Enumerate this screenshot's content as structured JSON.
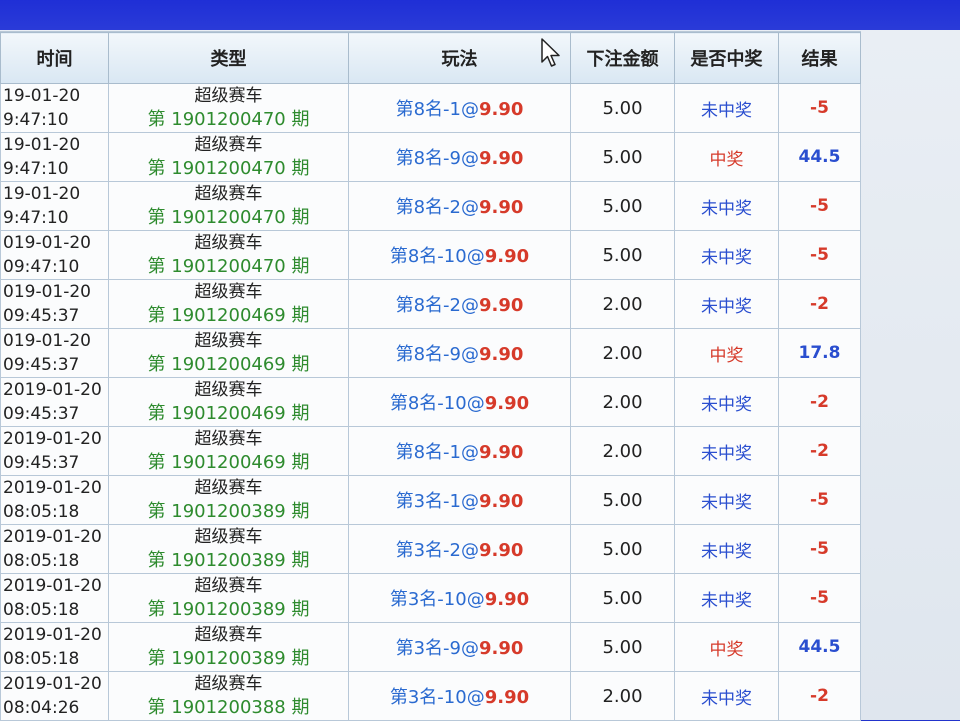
{
  "table": {
    "headers": [
      "时间",
      "类型",
      "玩法",
      "下注金额",
      "是否中奖",
      "结果"
    ],
    "rows": [
      {
        "date": "19-01-20",
        "time": "9:47:10",
        "type": "超级赛车",
        "period": "第 1901200470 期",
        "play": "第8名-1@",
        "odds": "9.90",
        "amount": "5.00",
        "status": "未中奖",
        "result": "-5",
        "win": false
      },
      {
        "date": "19-01-20",
        "time": "9:47:10",
        "type": "超级赛车",
        "period": "第 1901200470 期",
        "play": "第8名-9@",
        "odds": "9.90",
        "amount": "5.00",
        "status": "中奖",
        "result": "44.5",
        "win": true
      },
      {
        "date": "19-01-20",
        "time": "9:47:10",
        "type": "超级赛车",
        "period": "第 1901200470 期",
        "play": "第8名-2@",
        "odds": "9.90",
        "amount": "5.00",
        "status": "未中奖",
        "result": "-5",
        "win": false
      },
      {
        "date": "019-01-20",
        "time": "09:47:10",
        "type": "超级赛车",
        "period": "第 1901200470 期",
        "play": "第8名-10@",
        "odds": "9.90",
        "amount": "5.00",
        "status": "未中奖",
        "result": "-5",
        "win": false
      },
      {
        "date": "019-01-20",
        "time": "09:45:37",
        "type": "超级赛车",
        "period": "第 1901200469 期",
        "play": "第8名-2@",
        "odds": "9.90",
        "amount": "2.00",
        "status": "未中奖",
        "result": "-2",
        "win": false
      },
      {
        "date": "019-01-20",
        "time": "09:45:37",
        "type": "超级赛车",
        "period": "第 1901200469 期",
        "play": "第8名-9@",
        "odds": "9.90",
        "amount": "2.00",
        "status": "中奖",
        "result": "17.8",
        "win": true
      },
      {
        "date": "2019-01-20",
        "time": "09:45:37",
        "type": "超级赛车",
        "period": "第 1901200469 期",
        "play": "第8名-10@",
        "odds": "9.90",
        "amount": "2.00",
        "status": "未中奖",
        "result": "-2",
        "win": false
      },
      {
        "date": "2019-01-20",
        "time": "09:45:37",
        "type": "超级赛车",
        "period": "第 1901200469 期",
        "play": "第8名-1@",
        "odds": "9.90",
        "amount": "2.00",
        "status": "未中奖",
        "result": "-2",
        "win": false
      },
      {
        "date": "2019-01-20",
        "time": "08:05:18",
        "type": "超级赛车",
        "period": "第 1901200389 期",
        "play": "第3名-1@",
        "odds": "9.90",
        "amount": "5.00",
        "status": "未中奖",
        "result": "-5",
        "win": false
      },
      {
        "date": "2019-01-20",
        "time": "08:05:18",
        "type": "超级赛车",
        "period": "第 1901200389 期",
        "play": "第3名-2@",
        "odds": "9.90",
        "amount": "5.00",
        "status": "未中奖",
        "result": "-5",
        "win": false
      },
      {
        "date": "2019-01-20",
        "time": "08:05:18",
        "type": "超级赛车",
        "period": "第 1901200389 期",
        "play": "第3名-10@",
        "odds": "9.90",
        "amount": "5.00",
        "status": "未中奖",
        "result": "-5",
        "win": false
      },
      {
        "date": "2019-01-20",
        "time": "08:05:18",
        "type": "超级赛车",
        "period": "第 1901200389 期",
        "play": "第3名-9@",
        "odds": "9.90",
        "amount": "5.00",
        "status": "中奖",
        "result": "44.5",
        "win": true
      },
      {
        "date": "2019-01-20",
        "time": "08:04:26",
        "type": "超级赛车",
        "period": "第 1901200388 期",
        "play": "第3名-10@",
        "odds": "9.90",
        "amount": "2.00",
        "status": "未中奖",
        "result": "-2",
        "win": false
      }
    ]
  },
  "colors": {
    "window_blue": "#2233cc",
    "period_green": "#2e8b2e",
    "play_blue": "#2a6ad0",
    "odds_red": "#d63a2a",
    "status_blue": "#2a4ecf"
  },
  "icons": {
    "cursor": "mouse-pointer-icon"
  }
}
